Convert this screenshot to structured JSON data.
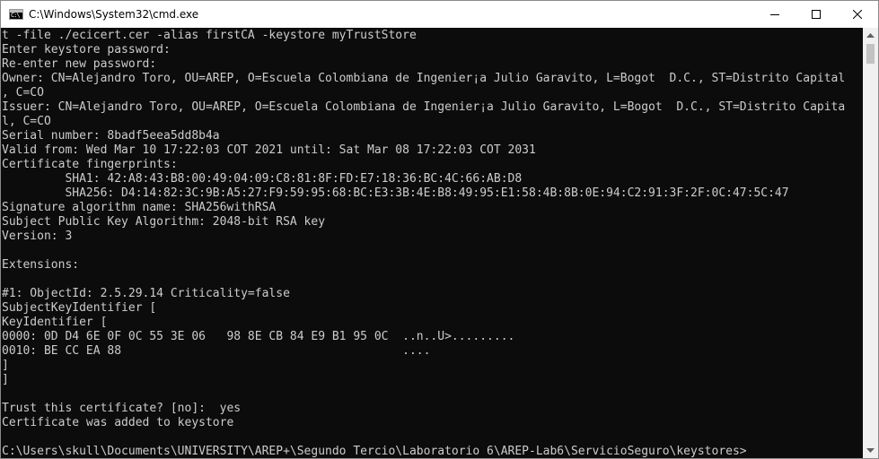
{
  "window": {
    "title": "C:\\Windows\\System32\\cmd.exe",
    "icon": "cmd-icon",
    "icon_glyph": "C:\\",
    "controls": [
      "minimize-icon",
      "maximize-icon",
      "close-icon"
    ]
  },
  "console": {
    "lines": [
      "t -file ./ecicert.cer -alias firstCA -keystore myTrustStore",
      "Enter keystore password:",
      "Re-enter new password:",
      "Owner: CN=Alejandro Toro, OU=AREP, O=Escuela Colombiana de Ingenier¡a Julio Garavito, L=Bogot  D.C., ST=Distrito Capital",
      ", C=CO",
      "Issuer: CN=Alejandro Toro, OU=AREP, O=Escuela Colombiana de Ingenier¡a Julio Garavito, L=Bogot  D.C., ST=Distrito Capita",
      "l, C=CO",
      "Serial number: 8badf5eea5dd8b4a",
      "Valid from: Wed Mar 10 17:22:03 COT 2021 until: Sat Mar 08 17:22:03 COT 2031",
      "Certificate fingerprints:",
      "         SHA1: 42:A8:43:B8:00:49:04:09:C8:81:8F:FD:E7:18:36:BC:4C:66:AB:D8",
      "         SHA256: D4:14:82:3C:9B:A5:27:F9:59:95:68:BC:E3:3B:4E:B8:49:95:E1:58:4B:8B:0E:94:C2:91:3F:2F:0C:47:5C:47",
      "Signature algorithm name: SHA256withRSA",
      "Subject Public Key Algorithm: 2048-bit RSA key",
      "Version: 3",
      "",
      "Extensions:",
      "",
      "#1: ObjectId: 2.5.29.14 Criticality=false",
      "SubjectKeyIdentifier [",
      "KeyIdentifier [",
      "0000: 0D D4 6E 0F 0C 55 3E 06   98 8E CB 84 E9 B1 95 0C  ..n..U>.........",
      "0010: BE CC EA 88                                        ....",
      "]",
      "]",
      "",
      "Trust this certificate? [no]:  yes",
      "Certificate was added to keystore",
      "",
      "C:\\Users\\skull\\Documents\\UNIVERSITY\\AREP+\\Segundo Tercio\\Laboratorio 6\\AREP-Lab6\\ServicioSeguro\\keystores>"
    ]
  },
  "colors": {
    "console_background": "#0c0c0c",
    "console_text": "#cccccc",
    "titlebar_background": "#ffffff",
    "scrollbar_track": "#f0f0f0",
    "scrollbar_thumb": "#c2c2c2"
  }
}
